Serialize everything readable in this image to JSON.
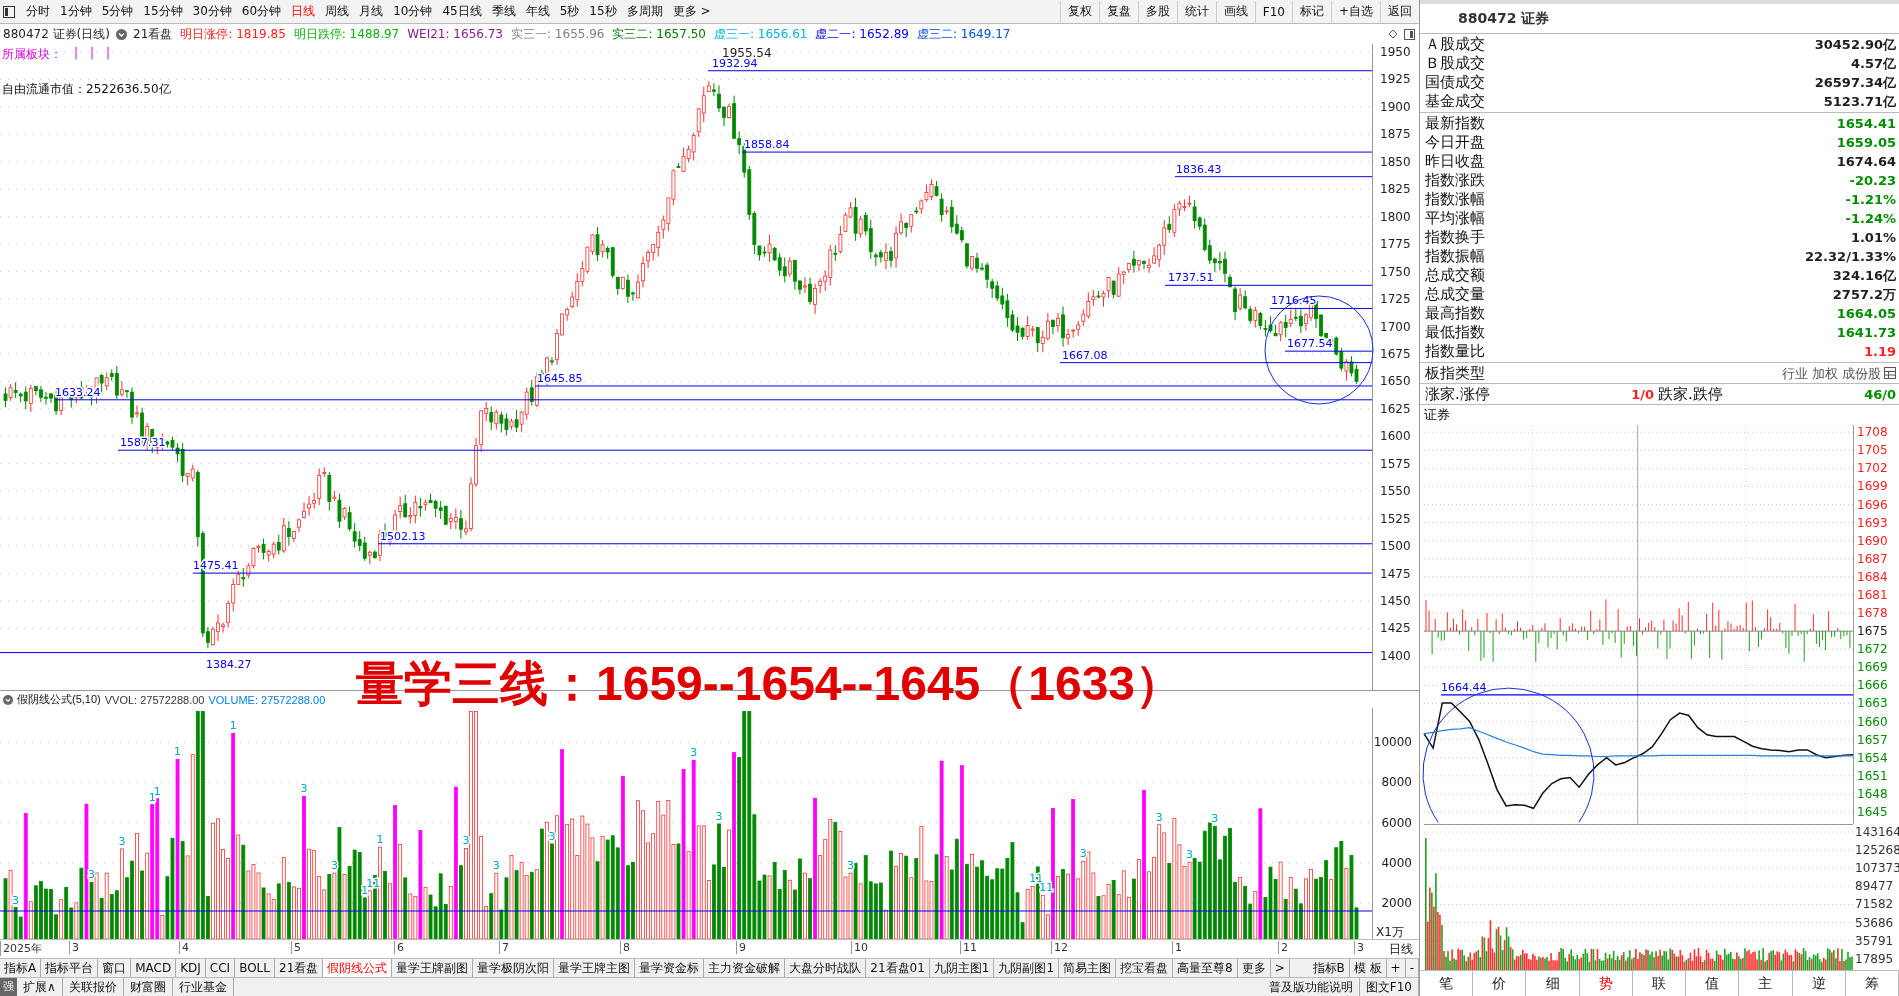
{
  "toolbar": {
    "periods": [
      {
        "label": "分时",
        "selected": false
      },
      {
        "label": "1分钟",
        "selected": false
      },
      {
        "label": "5分钟",
        "selected": false
      },
      {
        "label": "15分钟",
        "selected": false
      },
      {
        "label": "30分钟",
        "selected": false
      },
      {
        "label": "60分钟",
        "selected": false
      },
      {
        "label": "日线",
        "selected": true
      },
      {
        "label": "周线",
        "selected": false
      },
      {
        "label": "月线",
        "selected": false
      },
      {
        "label": "10分钟",
        "selected": false
      },
      {
        "label": "45日线",
        "selected": false
      },
      {
        "label": "季线",
        "selected": false
      },
      {
        "label": "年线",
        "selected": false
      },
      {
        "label": "5秒",
        "selected": false
      },
      {
        "label": "15秒",
        "selected": false
      },
      {
        "label": "多周期",
        "selected": false
      },
      {
        "label": "更多 >",
        "selected": false
      }
    ],
    "actions": [
      "复权",
      "复盘",
      "多股",
      "统计",
      "画线",
      "F10",
      "标记",
      "+自选",
      "返回"
    ]
  },
  "chart_header": {
    "code": "880472 证券(日线)",
    "indicator": "21看盘",
    "fields": [
      {
        "label": "明日涨停:",
        "value": "1819.85",
        "color": "#ff2020"
      },
      {
        "label": "明日跌停:",
        "value": "1488.97",
        "color": "#10b010"
      },
      {
        "label": "WEI21:",
        "value": "1656.73",
        "color": "#8b1a8b"
      },
      {
        "label": "实三一:",
        "value": "1655.96",
        "color": "#808080"
      },
      {
        "label": "实三二:",
        "value": "1657.50",
        "color": "#007800"
      },
      {
        "label": "虚三一:",
        "value": "1656.61",
        "color": "#00b4e0"
      },
      {
        "label": "虚二一:",
        "value": "1652.89",
        "color": "#0000ff"
      },
      {
        "label": "虚三二:",
        "value": "1649.17",
        "color": "#0050e0"
      }
    ]
  },
  "sector": {
    "label": "所属板块：",
    "marks": [
      "|",
      "|",
      "|"
    ]
  },
  "float_cap": "自由流通市值：2522636.50亿",
  "price_axis": [
    "1950",
    "1925",
    "1900",
    "1875",
    "1850",
    "1825",
    "1800",
    "1775",
    "1750",
    "1725",
    "1700",
    "1675",
    "1650",
    "1625",
    "1600",
    "1575",
    "1550",
    "1525",
    "1500",
    "1475",
    "1450",
    "1425",
    "1400"
  ],
  "price_labels": [
    {
      "text": "1955.54"
    },
    {
      "text": "1932.94"
    },
    {
      "text": "1858.84"
    },
    {
      "text": "1836.43"
    },
    {
      "text": "1737.51"
    },
    {
      "text": "1716.45"
    },
    {
      "text": "1677.54"
    },
    {
      "text": "1667.08"
    },
    {
      "text": "1645.85"
    },
    {
      "text": "1633.24"
    },
    {
      "text": "1587.31"
    },
    {
      "text": "1502.13"
    },
    {
      "text": "1475.41"
    },
    {
      "text": "1384.27"
    }
  ],
  "overlay_text": "量学三线：1659--1654--1645（1633）",
  "volume": {
    "title": "假阴线公式(5,10)",
    "vvol": "VVOL: 27572288.00",
    "volume": "VOLUME: 27572288.00",
    "axis": [
      "10000",
      "8000",
      "6000",
      "4000",
      "2000"
    ],
    "unit": "X1万",
    "marks": [
      "3",
      "3",
      "3",
      "1",
      "1",
      "1",
      "1",
      "3",
      "3",
      "1",
      "11",
      "1",
      "3",
      "3",
      "3",
      "3",
      "3",
      "3",
      "11",
      "11",
      "3",
      "3",
      "3",
      "3"
    ]
  },
  "date_axis": [
    "2025年",
    "3",
    "4",
    "5",
    "6",
    "7",
    "8",
    "9",
    "10",
    "11",
    "12",
    "1",
    "2",
    "3"
  ],
  "period_label": "日线",
  "indicator_tabs": [
    {
      "label": "指标A",
      "selected": false
    },
    {
      "label": "指标平台",
      "selected": false
    },
    {
      "label": "窗口",
      "selected": false
    },
    {
      "label": "MACD",
      "selected": false
    },
    {
      "label": "KDJ",
      "selected": false
    },
    {
      "label": "CCI",
      "selected": false
    },
    {
      "label": "BOLL",
      "selected": false
    },
    {
      "label": "21看盘",
      "selected": false
    },
    {
      "label": "假阴线公式",
      "selected": true
    },
    {
      "label": "量学王牌副图",
      "selected": false
    },
    {
      "label": "量学极阴次阳",
      "selected": false
    },
    {
      "label": "量学王牌主图",
      "selected": false
    },
    {
      "label": "量学资金标",
      "selected": false
    },
    {
      "label": "主力资金破解",
      "selected": false
    },
    {
      "label": "大盘分时战队",
      "selected": false
    },
    {
      "label": "21看盘01",
      "selected": false
    },
    {
      "label": "九阴主图1",
      "selected": false
    },
    {
      "label": "九阴副图1",
      "selected": false
    },
    {
      "label": "简易主图",
      "selected": false
    },
    {
      "label": "挖宝看盘",
      "selected": false
    },
    {
      "label": "高量至尊8",
      "selected": false
    },
    {
      "label": "更多",
      "selected": false
    },
    {
      "label": ">",
      "selected": false
    }
  ],
  "right_tabs": [
    "指标B",
    "模 板",
    "+",
    "-"
  ],
  "bottom_bar": {
    "badge": "强",
    "links": [
      "扩展∧",
      "关联报价",
      "财富圈",
      "行业基金"
    ],
    "right_links": [
      "普及版功能说明",
      "图文F10"
    ]
  },
  "panel": {
    "title": "880472 证券",
    "groups": [
      [
        {
          "label": "Ａ股成交",
          "value": "30452.90亿",
          "kind": "flat"
        },
        {
          "label": "Ｂ股成交",
          "value": "4.57亿",
          "kind": "flat"
        },
        {
          "label": "国债成交",
          "value": "26597.34亿",
          "kind": "flat"
        },
        {
          "label": "基金成交",
          "value": "5123.71亿",
          "kind": "flat"
        }
      ],
      [
        {
          "label": "最新指数",
          "value": "1654.41",
          "kind": "down"
        },
        {
          "label": "今日开盘",
          "value": "1659.05",
          "kind": "down"
        },
        {
          "label": "昨日收盘",
          "value": "1674.64",
          "kind": "flat"
        },
        {
          "label": "指数涨跌",
          "value": "-20.23",
          "kind": "down"
        },
        {
          "label": "指数涨幅",
          "value": "-1.21%",
          "kind": "down"
        },
        {
          "label": "平均涨幅",
          "value": "-1.24%",
          "kind": "down"
        },
        {
          "label": "指数换手",
          "value": "1.01%",
          "kind": "flat"
        },
        {
          "label": "指数振幅",
          "value": "22.32/1.33%",
          "kind": "flat"
        },
        {
          "label": "总成交额",
          "value": "324.16亿",
          "kind": "flat"
        },
        {
          "label": "总成交量",
          "value": "2757.2万",
          "kind": "flat"
        },
        {
          "label": "最高指数",
          "value": "1664.05",
          "kind": "down"
        },
        {
          "label": "最低指数",
          "value": "1641.73",
          "kind": "down"
        },
        {
          "label": "指数量比",
          "value": "1.19",
          "kind": "up"
        }
      ]
    ],
    "board": {
      "label": "板指类型",
      "value": "行业 加权 成份股"
    },
    "breadth": {
      "up_label": "涨家.涨停",
      "up_value": "1/0",
      "down_label": "跌家.跌停",
      "down_value": "46/0"
    },
    "intraday": {
      "title": "证券",
      "high_label": "1664.44",
      "axis": [
        {
          "text": "1708",
          "kind": "up"
        },
        {
          "text": "1705",
          "kind": "up"
        },
        {
          "text": "1702",
          "kind": "up"
        },
        {
          "text": "1699",
          "kind": "up"
        },
        {
          "text": "1696",
          "kind": "up"
        },
        {
          "text": "1693",
          "kind": "up"
        },
        {
          "text": "1690",
          "kind": "up"
        },
        {
          "text": "1687",
          "kind": "up"
        },
        {
          "text": "1684",
          "kind": "up"
        },
        {
          "text": "1681",
          "kind": "up"
        },
        {
          "text": "1678",
          "kind": "up"
        },
        {
          "text": "1675",
          "kind": "flat"
        },
        {
          "text": "1672",
          "kind": "down"
        },
        {
          "text": "1669",
          "kind": "down"
        },
        {
          "text": "1666",
          "kind": "down"
        },
        {
          "text": "1663",
          "kind": "down"
        },
        {
          "text": "1660",
          "kind": "down"
        },
        {
          "text": "1657",
          "kind": "down"
        },
        {
          "text": "1654",
          "kind": "down"
        },
        {
          "text": "1651",
          "kind": "down"
        },
        {
          "text": "1648",
          "kind": "down"
        },
        {
          "text": "1645",
          "kind": "down"
        }
      ],
      "volume_axis": [
        "143164",
        "125268",
        "107373",
        "89477",
        "71582",
        "53686",
        "35791",
        "17895"
      ],
      "chart_data": {
        "type": "line",
        "ylim": [
          1643,
          1709.2
        ],
        "yticks": [
          1708,
          1705,
          1702,
          1699,
          1696,
          1693,
          1690,
          1687,
          1684,
          1681,
          1678,
          1675,
          1672,
          1669,
          1666,
          1663,
          1660,
          1657,
          1654,
          1651,
          1648,
          1645
        ],
        "grid": true,
        "series": [
          {
            "color": "#111111",
            "values": [
              1658,
              1655.6,
              1663.1,
              1663.1,
              1661.6,
              1660,
              1657,
              1653,
              1648.7,
              1646,
              1646.2,
              1646.1,
              1645.6,
              1648.1,
              1649.7,
              1650.5,
              1650.7,
              1649.1,
              1651.2,
              1652.8,
              1654,
              1652.8,
              1653.2,
              1654,
              1654.7,
              1655.8,
              1657.9,
              1660.3,
              1661.4,
              1661,
              1659,
              1657.8,
              1657.5,
              1657.5,
              1657.5,
              1656.7,
              1655.9,
              1655.5,
              1655.3,
              1655.2,
              1655,
              1655.3,
              1655.3,
              1654.5,
              1654,
              1654.2,
              1654.4,
              1654.5
            ]
          },
          {
            "color": "#2080e0",
            "values": [
              1658,
              1658.2,
              1658.5,
              1658.7,
              1658.8,
              1659,
              1658.4,
              1657.8,
              1657.2,
              1656.6,
              1656.1,
              1655.6,
              1655,
              1654.6,
              1654.5,
              1654.4,
              1654.4,
              1654.3,
              1654.3,
              1654.2,
              1654.2,
              1654.3,
              1654.3,
              1654.3,
              1654.3,
              1654.3,
              1654.4,
              1654.4,
              1654.4,
              1654.4,
              1654.4,
              1654.4,
              1654.4,
              1654.4,
              1654.4,
              1654.4,
              1654.4,
              1654.3,
              1654.3,
              1654.3,
              1654.3,
              1654.3,
              1654.3,
              1654.3,
              1654.3,
              1654.3,
              1654.3,
              1654.3
            ]
          }
        ]
      }
    },
    "tabs": [
      {
        "label": "笔",
        "selected": false
      },
      {
        "label": "价",
        "selected": false
      },
      {
        "label": "细",
        "selected": false
      },
      {
        "label": "势",
        "selected": true
      },
      {
        "label": "联",
        "selected": false
      },
      {
        "label": "值",
        "selected": false
      },
      {
        "label": "主",
        "selected": false
      },
      {
        "label": "逆",
        "selected": false
      },
      {
        "label": "筹",
        "selected": false
      }
    ]
  }
}
